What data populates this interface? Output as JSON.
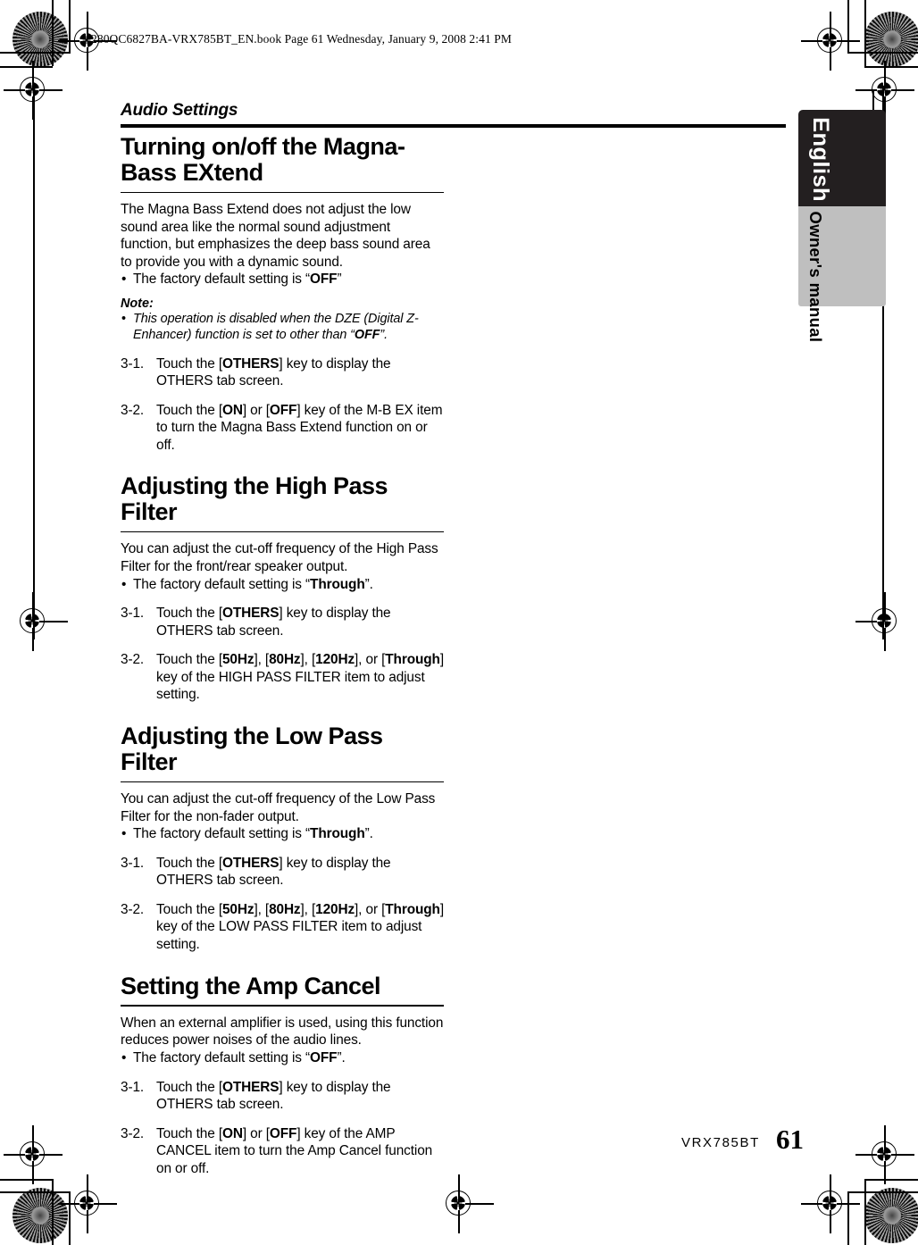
{
  "file_banner": "280QC6827BA-VRX785BT_EN.book  Page 61  Wednesday, January 9, 2008  2:41 PM",
  "running_head": "Audio Settings",
  "side_tab": {
    "language": "English",
    "manual": "Owner's manual",
    "black_color": "#231f20",
    "gray_color": "#bfbfbf"
  },
  "footer": {
    "model": "VRX785BT",
    "page_number": "61"
  },
  "sections": [
    {
      "title": "Turning on/off the Magna-Bass EXtend",
      "body": "The Magna Bass Extend does not adjust the low sound area like the normal sound adjustment function, but emphasizes the deep bass sound area to provide you with a dynamic sound.",
      "bullet_prefix": "The factory default setting is “",
      "bullet_bold": "OFF",
      "bullet_suffix": "”",
      "note_label": "Note:",
      "note_prefix": "This operation is disabled when the DZE (Digital Z-Enhancer) function is set to other than “",
      "note_bold": "OFF",
      "note_suffix": "”.",
      "steps": [
        {
          "num": "3-1.",
          "pre": "Touch the [",
          "bold": "OTHERS",
          "post": "] key to display the OTHERS tab screen."
        },
        {
          "num": "3-2.",
          "pre": "Touch the [",
          "bold": "ON",
          "mid": "] or [",
          "bold2": "OFF",
          "post": "] key of the M-B EX item to turn the Magna Bass Extend function on or off."
        }
      ]
    },
    {
      "title": "Adjusting the High Pass Filter",
      "body": "You can adjust the cut-off frequency of the High Pass Filter for the front/rear speaker output.",
      "bullet_prefix": "The factory default setting is “",
      "bullet_bold": "Through",
      "bullet_suffix": "”.",
      "steps": [
        {
          "num": "3-1.",
          "pre": "Touch the [",
          "bold": "OTHERS",
          "post": "] key to display the OTHERS tab screen."
        },
        {
          "num": "3-2.",
          "pre": "Touch the [",
          "bold": "50Hz",
          "mid": "], [",
          "bold2": "80Hz",
          "mid2": "], [",
          "bold3": "120Hz",
          "mid3": "], or [",
          "bold4": "Through",
          "post": "] key of the HIGH PASS FILTER item to adjust setting."
        }
      ]
    },
    {
      "title": "Adjusting the Low Pass Filter",
      "body": "You can adjust the cut-off frequency of the Low Pass Filter for the non-fader output.",
      "bullet_prefix": "The factory default setting is “",
      "bullet_bold": "Through",
      "bullet_suffix": "”.",
      "steps": [
        {
          "num": "3-1.",
          "pre": "Touch the [",
          "bold": "OTHERS",
          "post": "] key to display the OTHERS tab screen."
        },
        {
          "num": "3-2.",
          "pre": "Touch the [",
          "bold": "50Hz",
          "mid": "], [",
          "bold2": "80Hz",
          "mid2": "], [",
          "bold3": "120Hz",
          "mid3": "], or [",
          "bold4": "Through",
          "post": "] key of the LOW PASS FILTER item to adjust setting."
        }
      ]
    },
    {
      "title": "Setting the Amp Cancel",
      "body": "When an external amplifier is used, using this function reduces power noises of the audio lines.",
      "bullet_prefix": "The factory default setting is “",
      "bullet_bold": "OFF",
      "bullet_suffix": "”.",
      "steps": [
        {
          "num": "3-1.",
          "pre": "Touch the [",
          "bold": "OTHERS",
          "post": "] key to display the OTHERS tab screen."
        },
        {
          "num": "3-2.",
          "pre": "Touch the [",
          "bold": "ON",
          "mid": "] or [",
          "bold2": "OFF",
          "post": "] key of the AMP CANCEL item to turn the Amp Cancel function on or off."
        }
      ]
    }
  ]
}
